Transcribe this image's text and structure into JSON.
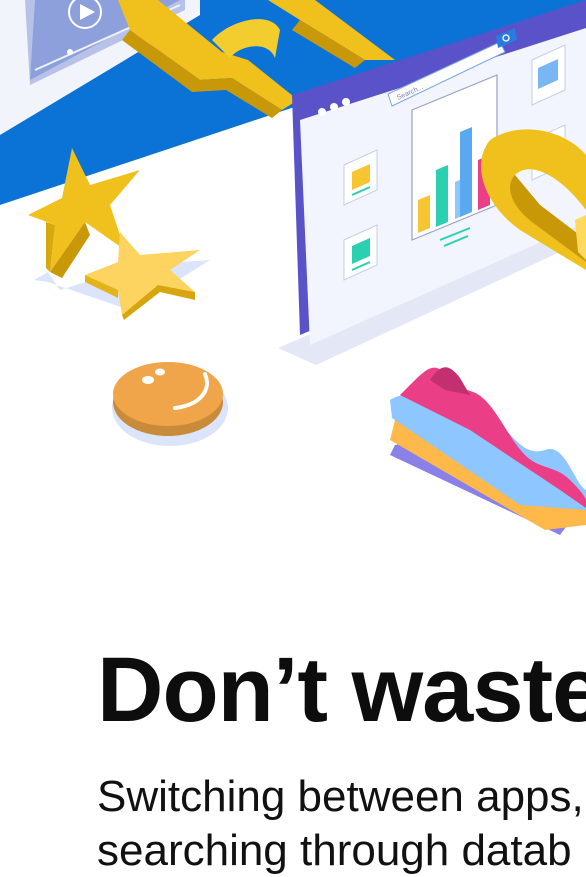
{
  "hero": {
    "search_placeholder": "Search..."
  },
  "headline": "Don’t waste",
  "subtext_lines": [
    "Switching between apps,",
    "searching through datab"
  ],
  "colors": {
    "brand_blue": "#0b72d6",
    "gold": "#f0c11c",
    "gold_dark": "#c89808",
    "purple": "#5a52c8",
    "pink": "#ea3f86",
    "sky": "#8ec7ff",
    "orange": "#ffb84a",
    "teal": "#2ad0b0"
  }
}
